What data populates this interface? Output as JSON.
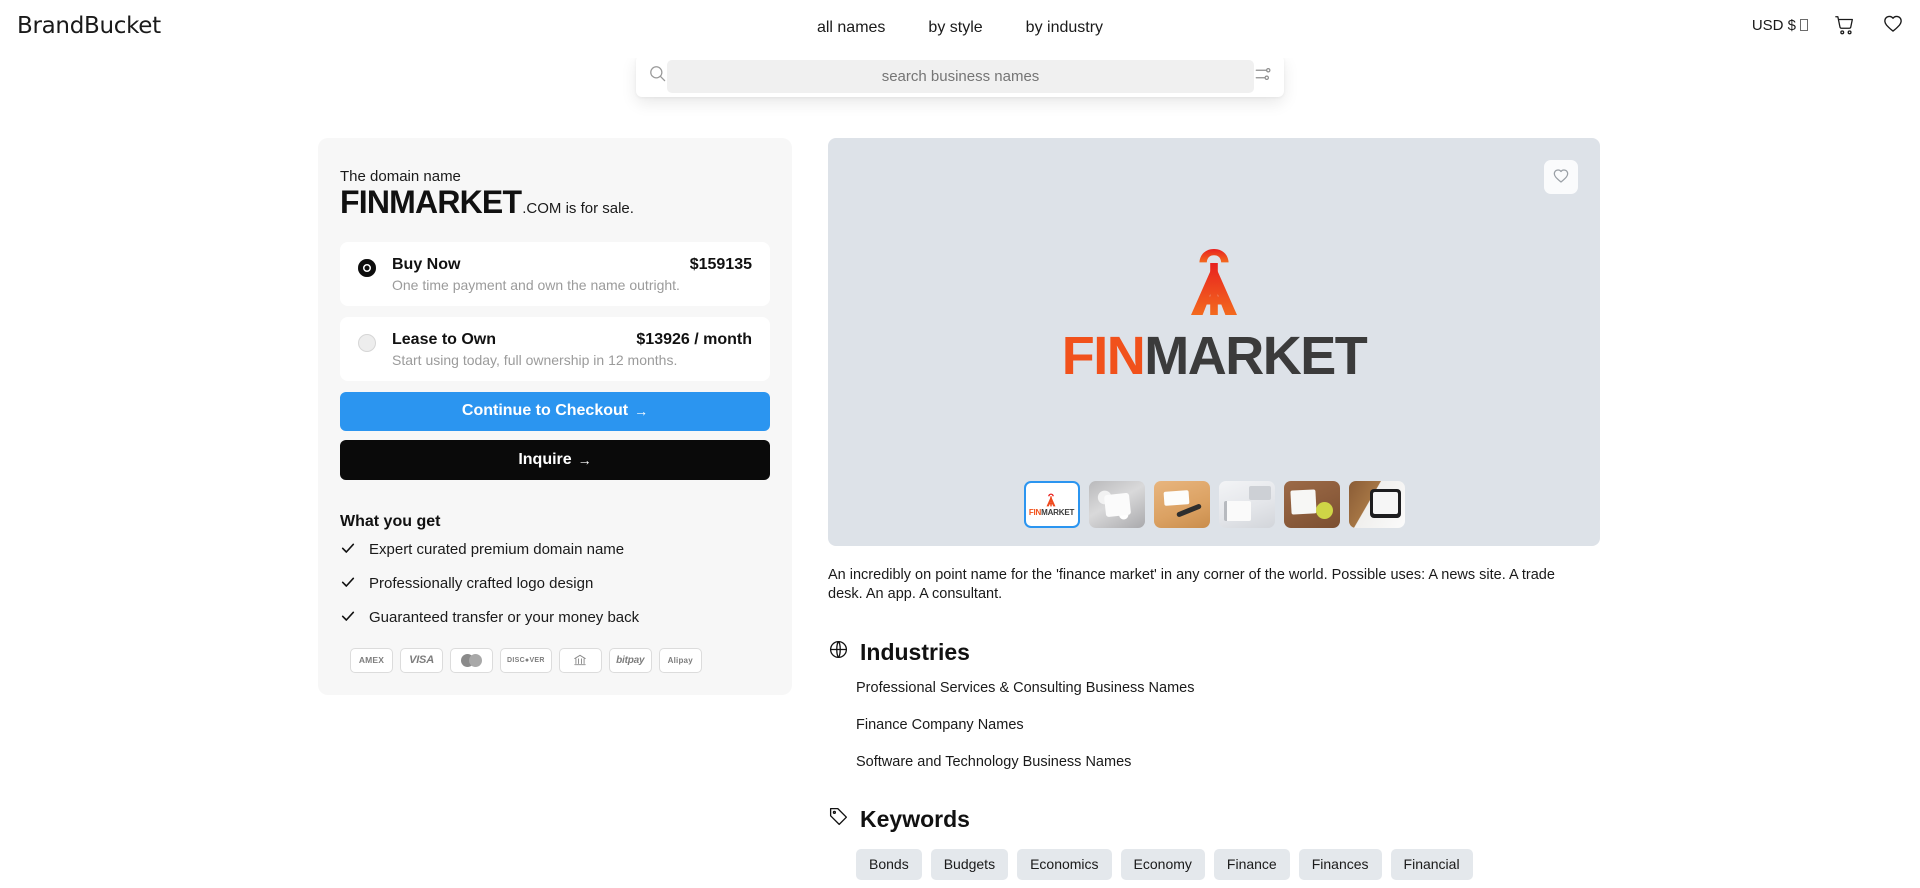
{
  "header": {
    "brand": "BrandBucket",
    "nav": [
      {
        "label": "all names"
      },
      {
        "label": "by style"
      },
      {
        "label": "by industry"
      }
    ],
    "currency": "USD $",
    "cart_icon": "shopping-cart-icon",
    "wishlist_icon": "heart-icon"
  },
  "search": {
    "placeholder": "search business names",
    "value": "",
    "left_icon": "search-icon",
    "right_icon": "filter-sliders-icon"
  },
  "offer": {
    "pre_label": "The domain name",
    "domain_name": "FINMARKET",
    "domain_suffix": ".COM is for sale.",
    "options": [
      {
        "title": "Buy Now",
        "price": "$159135",
        "subtitle": "One time payment and own the name outright.",
        "selected": true
      },
      {
        "title": "Lease to Own",
        "price": "$13926 / month",
        "subtitle": "Start using today, full ownership in 12 months.",
        "selected": false
      }
    ],
    "checkout_label": "Continue to Checkout",
    "checkout_arrow": "→",
    "inquire_label": "Inquire",
    "inquire_arrow": "→",
    "accent_color": "#2b95f0",
    "inquire_color": "#0a0a0a"
  },
  "what_you_get": {
    "title": "What you get",
    "items": [
      "Expert curated premium domain name",
      "Professionally crafted logo design",
      "Guaranteed transfer or your money back"
    ]
  },
  "payments": [
    {
      "name": "AMEX",
      "label": "AMEX",
      "style": "amex"
    },
    {
      "name": "VISA",
      "label": "VISA",
      "style": "visa"
    },
    {
      "name": "Mastercard",
      "label": "",
      "style": "mc"
    },
    {
      "name": "DISCOVER",
      "label": "DISC●VER",
      "style": "discover"
    },
    {
      "name": "Bank transfer",
      "label": "",
      "style": "bank"
    },
    {
      "name": "bitpay",
      "label": "bitpay",
      "style": "bitpay"
    },
    {
      "name": "Alipay",
      "label": "Alipay",
      "style": "alipay"
    }
  ],
  "preview": {
    "background_color": "#dde2e8",
    "favorite_icon": "heart-icon",
    "logo_mark": "shopping-bag-a-icon",
    "logo_text_first": "FIN",
    "logo_text_second": "MARKET",
    "logo_first_color": "#f1511b",
    "logo_second_color": "#3b3b3b",
    "thumbnails": [
      {
        "name": "logo-thumbnail",
        "selected": true,
        "style": "logo"
      },
      {
        "name": "mockup-desk-gray",
        "selected": false,
        "style": "ph1"
      },
      {
        "name": "mockup-card-glasses",
        "selected": false,
        "style": "ph2"
      },
      {
        "name": "mockup-notebook-laptop",
        "selected": false,
        "style": "ph3"
      },
      {
        "name": "mockup-notebook-coffee",
        "selected": false,
        "style": "ph4"
      },
      {
        "name": "mockup-tablet-wood",
        "selected": false,
        "style": "ph5"
      }
    ]
  },
  "description": "An incredibly on point name for the 'finance market' in any corner of the world. Possible uses: A news site. A trade desk. An app. A consultant.",
  "industries": {
    "title": "Industries",
    "icon": "globe-icon",
    "items": [
      "Professional Services & Consulting Business Names",
      "Finance Company Names",
      "Software and Technology Business Names"
    ]
  },
  "keywords": {
    "title": "Keywords",
    "icon": "tag-icon",
    "items": [
      "Bonds",
      "Budgets",
      "Economics",
      "Economy",
      "Finance",
      "Finances",
      "Financial"
    ]
  }
}
